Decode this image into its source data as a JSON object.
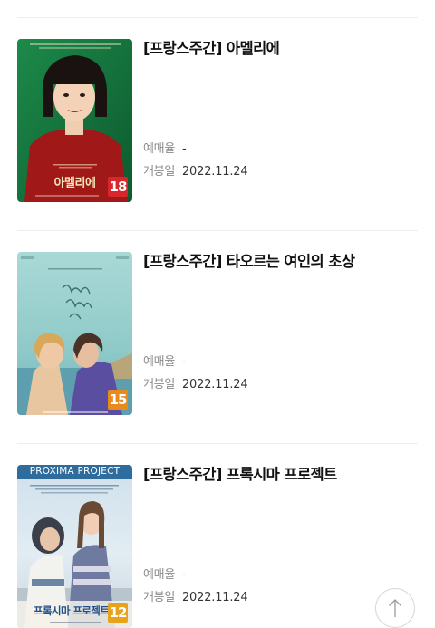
{
  "movies": [
    {
      "title": "[프랑스주간] 아멜리에",
      "rate_label": "예매율",
      "rate_value": "-",
      "release_label": "개봉일",
      "release_value": "2022.11.24",
      "age_rating": "18",
      "age_color": "#d7262c",
      "poster_title": "아멜리에"
    },
    {
      "title": "[프랑스주간] 타오르는 여인의 초상",
      "rate_label": "예매율",
      "rate_value": "-",
      "release_label": "개봉일",
      "release_value": "2022.11.24",
      "age_rating": "15",
      "age_color": "#e98a1e",
      "poster_title": "타오르는 여인의 초상"
    },
    {
      "title": "[프랑스주간] 프록시마 프로젝트",
      "rate_label": "예매율",
      "rate_value": "-",
      "release_label": "개봉일",
      "release_value": "2022.11.24",
      "age_rating": "12",
      "age_color": "#e9a21e",
      "poster_header": "PROXIMA PROJECT",
      "poster_title": "프록시마 프로젝트"
    }
  ],
  "scroll_top": {
    "icon": "arrow-up-icon"
  }
}
